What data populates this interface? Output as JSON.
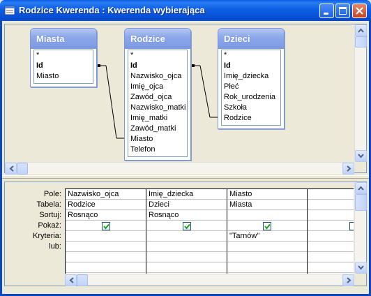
{
  "window": {
    "title": "Rodzice Kwerenda : Kwerenda wybierająca"
  },
  "tables": [
    {
      "name": "Miasta",
      "fields": [
        {
          "label": "*",
          "key": false
        },
        {
          "label": "Id",
          "key": true
        },
        {
          "label": "Miasto",
          "key": false
        }
      ]
    },
    {
      "name": "Rodzice",
      "fields": [
        {
          "label": "*",
          "key": false
        },
        {
          "label": "Id",
          "key": true
        },
        {
          "label": "Nazwisko_ojca",
          "key": false
        },
        {
          "label": "Imię_ojca",
          "key": false
        },
        {
          "label": "Zawód_ojca",
          "key": false
        },
        {
          "label": "Nazwisko_matki",
          "key": false
        },
        {
          "label": "Imię_matki",
          "key": false
        },
        {
          "label": "Zawód_matki",
          "key": false
        },
        {
          "label": "Miasto",
          "key": false
        },
        {
          "label": "Telefon",
          "key": false
        }
      ]
    },
    {
      "name": "Dzieci",
      "fields": [
        {
          "label": "*",
          "key": false
        },
        {
          "label": "Id",
          "key": true
        },
        {
          "label": "Imię_dziecka",
          "key": false
        },
        {
          "label": "Płeć",
          "key": false
        },
        {
          "label": "Rok_urodzenia",
          "key": false
        },
        {
          "label": "Szkoła",
          "key": false
        },
        {
          "label": "Rodzice",
          "key": false
        }
      ]
    }
  ],
  "grid": {
    "row_labels": [
      "Pole:",
      "Tabela:",
      "Sortuj:",
      "Pokaż:",
      "Kryteria:",
      "lub:"
    ],
    "columns": [
      {
        "field": "Nazwisko_ojca",
        "table": "Rodzice",
        "sort": "Rosnąco",
        "show": true,
        "criteria": "",
        "or": ""
      },
      {
        "field": "Imię_dziecka",
        "table": "Dzieci",
        "sort": "Rosnąco",
        "show": true,
        "criteria": "",
        "or": ""
      },
      {
        "field": "Miasto",
        "table": "Miasta",
        "sort": "",
        "show": true,
        "criteria": "\"Tarnów\"",
        "or": ""
      },
      {
        "field": "",
        "table": "",
        "sort": "",
        "show": false,
        "criteria": "",
        "or": ""
      }
    ]
  },
  "icons": {
    "title": "query-window-icon",
    "minimize": "minimize-icon",
    "maximize": "maximize-icon",
    "close": "close-icon"
  },
  "colors": {
    "titlebar": "#0a5ce6",
    "table_header": "#8da8ea",
    "checkmark": "#21a121"
  }
}
